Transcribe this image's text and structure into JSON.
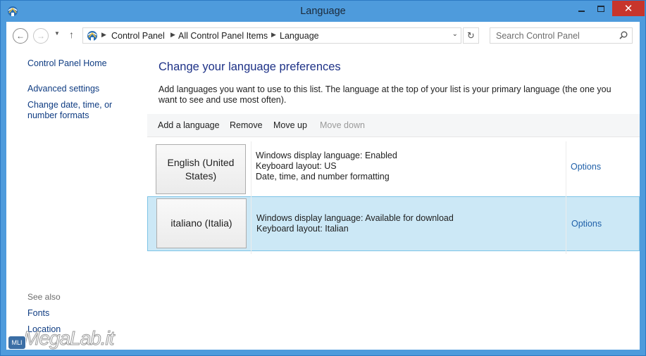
{
  "window": {
    "title": "Language",
    "buttons": {
      "minimize": "minimize",
      "maximize": "maximize",
      "close": "✕"
    }
  },
  "nav": {
    "back_icon": "←",
    "forward_icon": "→",
    "recent_icon": "▼",
    "up_icon": "↑",
    "breadcrumbs": [
      "Control Panel",
      "All Control Panel Items",
      "Language"
    ],
    "dropdown_icon": "⌄",
    "refresh_icon": "↻",
    "search_placeholder": "Search Control Panel"
  },
  "sidebar": {
    "home": "Control Panel Home",
    "links": [
      "Advanced settings",
      "Change date, time, or number formats"
    ],
    "see_also_heading": "See also",
    "see_also": [
      "Fonts",
      "Location"
    ]
  },
  "main": {
    "title": "Change your language preferences",
    "description": "Add languages you want to use to this list. The language at the top of your list is your primary language (the one you want to see and use most often).",
    "toolbar": {
      "add": "Add a language",
      "remove": "Remove",
      "move_up": "Move up",
      "move_down": "Move down"
    },
    "languages": [
      {
        "name": "English (United States)",
        "details": [
          "Windows display language: Enabled",
          "Keyboard layout: US",
          "Date, time, and number formatting"
        ],
        "options": "Options"
      },
      {
        "name": "italiano (Italia)",
        "details": [
          "Windows display language: Available for download",
          "Keyboard layout: Italian"
        ],
        "options": "Options"
      }
    ]
  },
  "watermark": {
    "text": "MegaLab.it",
    "badge": "MLI"
  },
  "colors": {
    "titlebar": "#4e9bdc",
    "close": "#c7352b",
    "link": "#0f3c82",
    "heading": "#1e3287",
    "selected_row": "#cce8f6"
  }
}
